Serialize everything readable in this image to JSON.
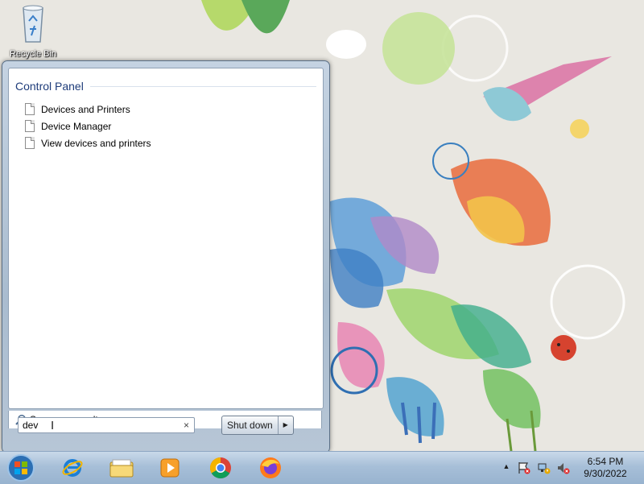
{
  "desktop": {
    "recycle_bin_label": "Recycle Bin"
  },
  "start_menu": {
    "group_title": "Control Panel",
    "results": [
      {
        "label": "Devices and Printers"
      },
      {
        "label": "Device Manager"
      },
      {
        "label": "View devices and printers"
      }
    ],
    "see_more_label": "See more results",
    "search_value": "dev",
    "clear_glyph": "×",
    "shutdown_label": "Shut down",
    "shutdown_arrow": "▶"
  },
  "taskbar": {
    "pinned": [
      "start-orb",
      "internet-explorer-icon",
      "file-explorer-icon",
      "media-player-icon",
      "chrome-icon",
      "firefox-icon"
    ],
    "tray_arrow": "▲",
    "time": "6:54 PM",
    "date": "9/30/2022"
  },
  "colors": {
    "accent": "#1e3c7a",
    "taskbar": "#a7bfd8"
  }
}
